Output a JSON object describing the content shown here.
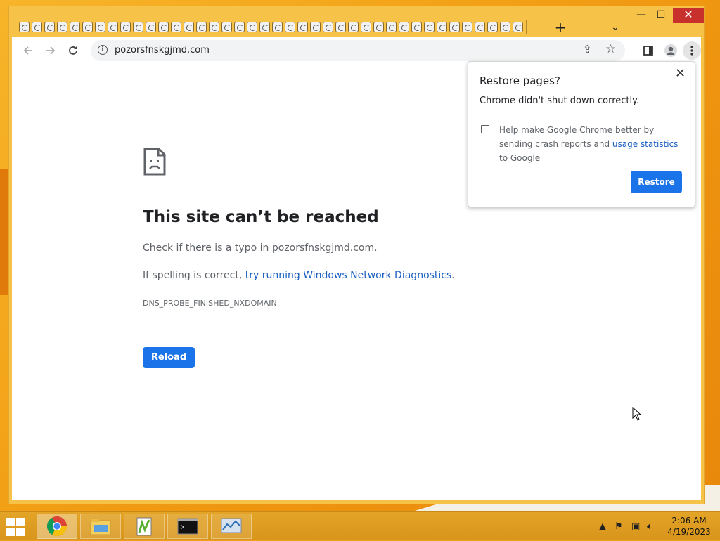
{
  "browser": {
    "url": "pozorsfnskgjmd.com",
    "tab_count_visible": 40,
    "new_tab_label": "+",
    "tab_search_label": "⌄",
    "window_controls": {
      "minimize": "—",
      "maximize": "☐",
      "close": "✕"
    }
  },
  "error_page": {
    "title": "This site can’t be reached",
    "check_text": "Check if there is a typo in pozorsfnskgjmd.com.",
    "spelling_prefix": "If spelling is correct, ",
    "diagnostics_link": "try running Windows Network Diagnostics",
    "spelling_suffix": ".",
    "error_code": "DNS_PROBE_FINISHED_NXDOMAIN",
    "reload_label": "Reload"
  },
  "restore_bubble": {
    "title": "Restore pages?",
    "message": "Chrome didn't shut down correctly.",
    "help_prefix": "Help make Google Chrome better by sending crash reports and ",
    "help_link": "usage statistics",
    "help_suffix": " to Google",
    "checkbox_checked": false,
    "restore_label": "Restore"
  },
  "taskbar": {
    "time": "2:06 AM",
    "date": "4/19/2023",
    "apps": [
      "chrome-icon",
      "file-explorer-icon",
      "notepad-plus-icon",
      "cmd-icon",
      "performance-monitor-icon"
    ]
  },
  "colors": {
    "accent": "#1a73e8",
    "window_frame": "#f6c248",
    "desktop": "#f3a318",
    "close_button": "#c7302b"
  }
}
